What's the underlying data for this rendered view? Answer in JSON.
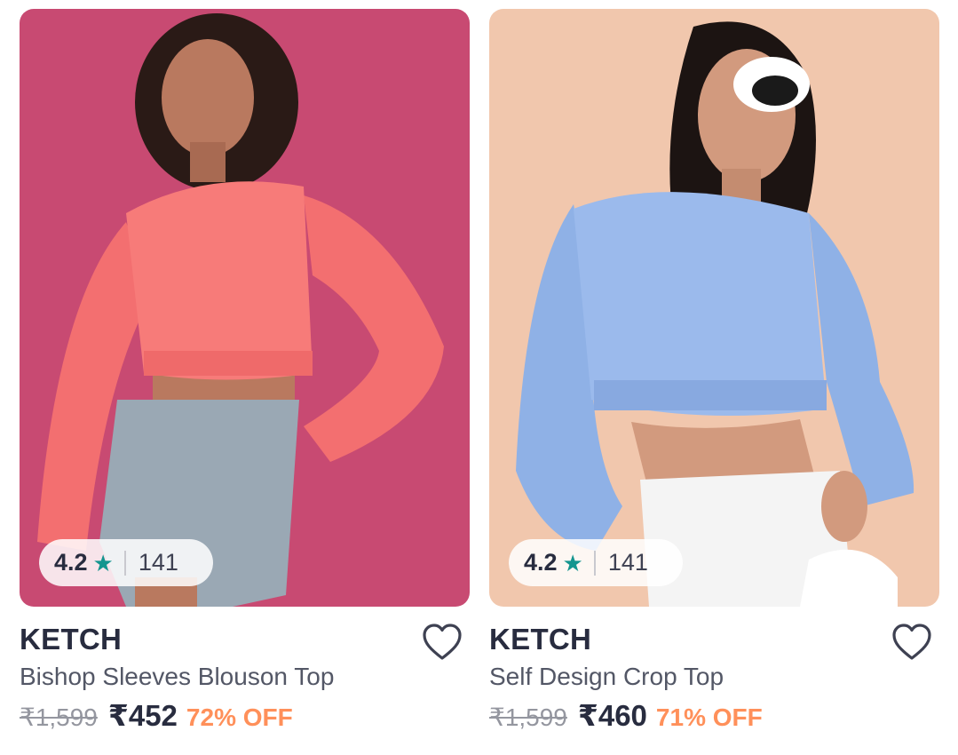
{
  "products": [
    {
      "image_alt": "Model wearing coral bishop sleeves blouson top with denim shorts",
      "rating": "4.2",
      "rating_count": "141",
      "brand": "KETCH",
      "name": "Bishop Sleeves Blouson Top",
      "mrp": "₹1,599",
      "price": "₹452",
      "discount": "72% OFF",
      "background_color": "#c84a72",
      "top_color": "#f77b79"
    },
    {
      "image_alt": "Model wearing blue self design crop top with white jeans and sunglasses",
      "rating": "4.2",
      "rating_count": "141",
      "brand": "KETCH",
      "name": "Self Design Crop Top",
      "mrp": "₹1,599",
      "price": "₹460",
      "discount": "71% OFF",
      "background_color": "#f1c7ad",
      "top_color": "#8fb1e6"
    }
  ],
  "icons": {
    "star": "star-icon",
    "wishlist": "heart-outline-icon"
  }
}
